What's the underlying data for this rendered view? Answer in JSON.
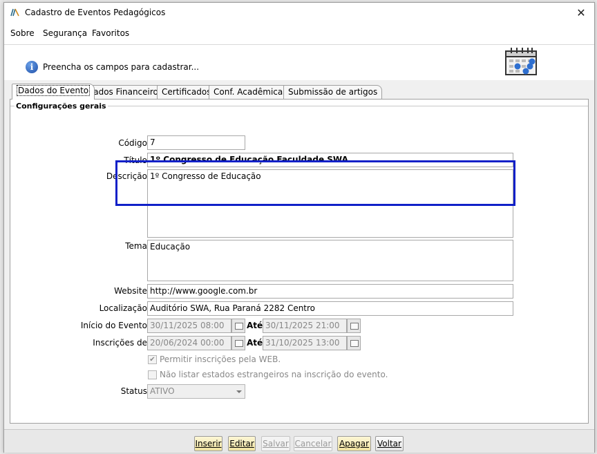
{
  "window": {
    "title": "Cadastro de Eventos Pedagógicos",
    "close": "✕"
  },
  "menu": [
    {
      "label": "Sobre"
    },
    {
      "label": "Segurança"
    },
    {
      "label": "Favoritos"
    }
  ],
  "info": {
    "icon": "info-icon",
    "text": "Preencha os campos para cadastrar..."
  },
  "tabs": [
    {
      "label": "Dados do Evento"
    },
    {
      "label": "Dados Financeiros"
    },
    {
      "label": "Certificados"
    },
    {
      "label": "Conf. Acadêmicas"
    },
    {
      "label": "Submissão de artigos"
    }
  ],
  "group": {
    "title": "Configurações gerais"
  },
  "form": {
    "codigo": {
      "label": "Código:",
      "value": "7"
    },
    "titulo": {
      "label": "Título:",
      "value": "1º Congresso de Educação Faculdade SWA"
    },
    "descricao": {
      "label": "Descrição:",
      "value": "1º Congresso de Educação"
    },
    "tema": {
      "label": "Tema:",
      "value": "Educação"
    },
    "website": {
      "label": "Website:",
      "value": "http://www.google.com.br"
    },
    "localizacao": {
      "label": "Localização:",
      "value": "Auditório SWA, Rua Paraná 2282 Centro"
    },
    "inicio": {
      "label": "Início do Evento:",
      "from": "30/11/2025 08:00",
      "ate_label": "Até:",
      "to": "30/11/2025 21:00"
    },
    "inscricoes": {
      "label": "Inscrições de:",
      "from": "20/06/2024 00:00",
      "ate_label": "Até:",
      "to": "31/10/2025 13:00"
    },
    "permitir_web": {
      "label": "Permitir inscrições pela WEB.",
      "checked": true
    },
    "nao_listar": {
      "label": "Não listar estados estrangeiros na inscrição do evento.",
      "checked": false
    },
    "status": {
      "label": "Status:",
      "value": "ATIVO"
    }
  },
  "buttons": {
    "inserir": "Inserir",
    "editar": "Editar",
    "salvar": "Salvar",
    "cancelar": "Cancelar",
    "apagar": "Apagar",
    "voltar": "Voltar"
  }
}
